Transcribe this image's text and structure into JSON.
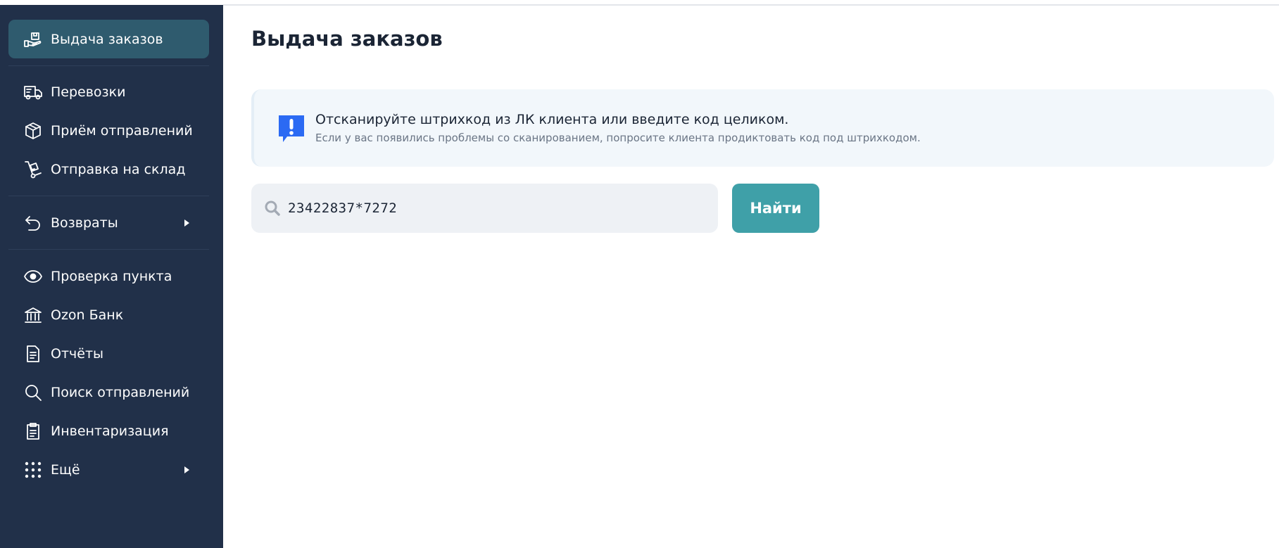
{
  "sidebar": {
    "items": [
      {
        "label": "Выдача заказов",
        "icon": "box-hand-icon",
        "active": true
      },
      {
        "label": "Перевозки",
        "icon": "truck-icon"
      },
      {
        "label": "Приём отправлений",
        "icon": "package-icon"
      },
      {
        "label": "Отправка на склад",
        "icon": "hand-truck-icon"
      },
      {
        "label": "Возвраты",
        "icon": "return-icon",
        "has_submenu": true
      },
      {
        "label": "Проверка пункта",
        "icon": "eye-icon"
      },
      {
        "label": "Ozon Банк",
        "icon": "bank-icon"
      },
      {
        "label": "Отчёты",
        "icon": "document-icon"
      },
      {
        "label": "Поиск отправлений",
        "icon": "search-icon"
      },
      {
        "label": "Инвентаризация",
        "icon": "clipboard-icon"
      },
      {
        "label": "Ещё",
        "icon": "grid-dots-icon",
        "has_submenu": true
      }
    ]
  },
  "main": {
    "title": "Выдача заказов",
    "info": {
      "title": "Отсканируйте штрихкод из ЛК клиента или введите код целиком.",
      "subtitle": "Если у вас появились проблемы со сканированием, попросите клиента продиктовать код под штрихкодом."
    },
    "search": {
      "value": "23422837*7272",
      "button_label": "Найти"
    }
  },
  "colors": {
    "sidebar_bg": "#213049",
    "active_item_bg": "#2f5b6e",
    "button_bg": "#3fa0a8",
    "info_icon": "#2b6af3"
  }
}
